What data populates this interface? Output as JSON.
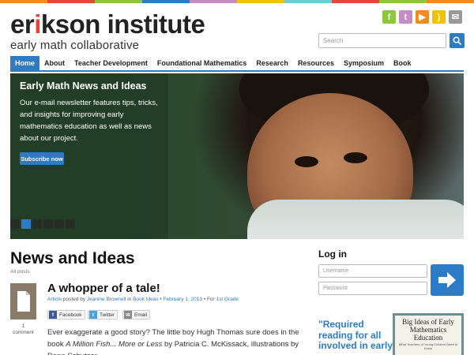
{
  "brand": {
    "name_pre": "er",
    "name_accent": "i",
    "name_post": "kson institute",
    "subtitle": "early math collaborative",
    "stripe_colors": [
      "#f58a1f",
      "#e8443a",
      "#8dc63f",
      "#2d7bc4",
      "#c68dc4",
      "#f2c200",
      "#6fcbd2",
      "#e8443a",
      "#8dc63f",
      "#f58a1f"
    ]
  },
  "social": [
    {
      "name": "facebook",
      "glyph": "f",
      "color": "#8dc63f"
    },
    {
      "name": "twitter",
      "glyph": "t",
      "color": "#c68dc4"
    },
    {
      "name": "youtube",
      "glyph": "▶",
      "color": "#f58a1f"
    },
    {
      "name": "rss",
      "glyph": ")",
      "color": "#f2c200"
    },
    {
      "name": "email",
      "glyph": "✉",
      "color": "#999999"
    }
  ],
  "search": {
    "placeholder": "Search"
  },
  "nav": {
    "items": [
      "Home",
      "About",
      "Teacher Development",
      "Foundational Mathematics",
      "Research",
      "Resources",
      "Symposium",
      "Book"
    ],
    "active": 0
  },
  "hero": {
    "title": "Early Math News and Ideas",
    "description": "Our e-mail newsletter features tips, tricks, and insights for improving early mathematics education as well as news about our project.",
    "button": "Subscribe now",
    "slides": 6,
    "active_slide": 1
  },
  "news": {
    "title": "News and Ideas",
    "all_posts": "All posts"
  },
  "post": {
    "title": "A whopper of a tale!",
    "type": "Article",
    "posted_by": "posted by",
    "author": "Jeanine Brownell",
    "in": "in",
    "category": "Book Ideas",
    "date": "February 1, 2013",
    "for": "For",
    "audience": "1st Grade",
    "comments_count": "1",
    "comments_label": "comment",
    "share_facebook": "Facebook",
    "share_twitter": "Twitter",
    "share_email": "Email",
    "excerpt_1": "Ever exaggerate a good story? The little boy Hugh Thomas sure does in the book ",
    "excerpt_book": "A Million Fish... More or Less",
    "excerpt_2": " by Patricia C. McKissack, illustrations by Dena Schutzer."
  },
  "login": {
    "title": "Log in",
    "username_placeholder": "Username",
    "password_placeholder": "Password"
  },
  "book": {
    "quote": "\"Required reading for all involved in early",
    "cover_title": "Big Ideas of Early Mathematics Education",
    "cover_sub": "What Teachers of Young Children Need to Know"
  },
  "colors": {
    "accent": "#2d7bc4",
    "logo_i": "#e8443a"
  }
}
